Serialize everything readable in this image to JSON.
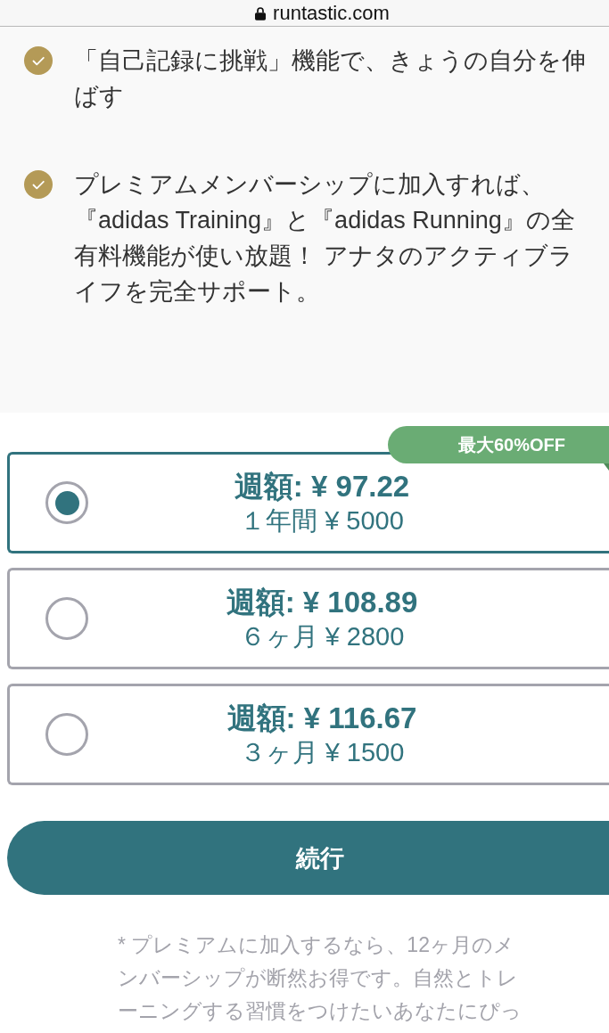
{
  "address_bar": {
    "url": "runtastic.com"
  },
  "features": [
    {
      "text": "「自己記録に挑戦」機能で、きょうの自分を伸ばす"
    },
    {
      "text": "プレミアムメンバーシップに加入すれば、『adidas Training』と『adidas Running』の全有料機能が使い放題！ アナタのアクティブライフを完全サポート。"
    }
  ],
  "plans": [
    {
      "weekly_price": "週額: ¥ 97.22",
      "period_price": "１年間 ¥ 5000",
      "selected": true,
      "badge": "最大60%OFF"
    },
    {
      "weekly_price": "週額: ¥ 108.89",
      "period_price": "６ヶ月 ¥ 2800",
      "selected": false
    },
    {
      "weekly_price": "週額: ¥ 116.67",
      "period_price": "３ヶ月 ¥ 1500",
      "selected": false
    }
  ],
  "continue_button": "続行",
  "footnote": "* プレミアムに加入するなら、12ヶ月のメンバーシップが断然お得です。自然とトレーニングする習慣をつけたいあなたにぴっ"
}
